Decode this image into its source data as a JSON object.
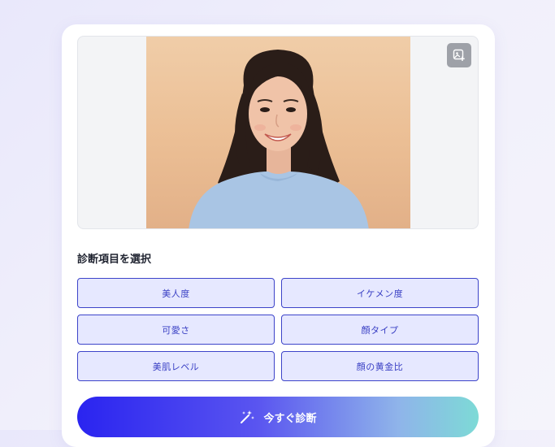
{
  "photo": {
    "alt": "Smiling woman with shoulder-length dark hair in a light blue sweater",
    "change_icon": "image-edit-icon"
  },
  "section": {
    "title": "診断項目を選択"
  },
  "options": [
    {
      "label": "美人度"
    },
    {
      "label": "イケメン度"
    },
    {
      "label": "可愛さ"
    },
    {
      "label": "顔タイプ"
    },
    {
      "label": "美肌レベル"
    },
    {
      "label": "顔の黄金比"
    }
  ],
  "cta": {
    "label": "今すぐ診断",
    "icon": "magic-wand-icon"
  },
  "colors": {
    "accent": "#3d44c9",
    "option_bg": "#e6e8ff",
    "cta_start": "#2a24f0",
    "cta_end": "#7ddad6"
  }
}
